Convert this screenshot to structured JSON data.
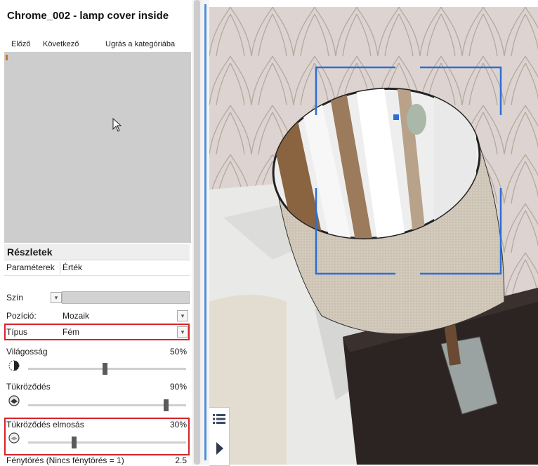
{
  "panel": {
    "title": "Chrome_002 - lamp cover inside",
    "nav": {
      "prev": "Előző",
      "next": "Következő",
      "category": "Ugrás a kategóriába"
    }
  },
  "details": {
    "heading": "Részletek",
    "columns": {
      "param": "Paraméterek",
      "value": "Érték"
    },
    "color": {
      "label": "Szín"
    },
    "position": {
      "label": "Pozíció:",
      "value": "Mozaik"
    },
    "type": {
      "label": "Típus",
      "value": "Fém"
    },
    "brightness": {
      "label": "Világosság",
      "percent": "50%",
      "level": 0.5
    },
    "reflection": {
      "label": "Tükröződés",
      "percent": "90%",
      "level": 0.9
    },
    "reflection_blur": {
      "label": "Tükröződés elmosás",
      "percent": "30%",
      "level": 0.3
    },
    "refraction": {
      "label": "Fénytörés (Nincs fénytörés = 1)",
      "value": "2.5"
    }
  },
  "colors": {
    "highlight": "#d8232a",
    "selection": "#2b6fd6",
    "accent": "#4f8fda"
  },
  "icons": [
    "cursor-arrow-icon",
    "brightness-icon",
    "reflection-icon",
    "list-icon",
    "play-icon",
    "chevron-down-icon"
  ]
}
